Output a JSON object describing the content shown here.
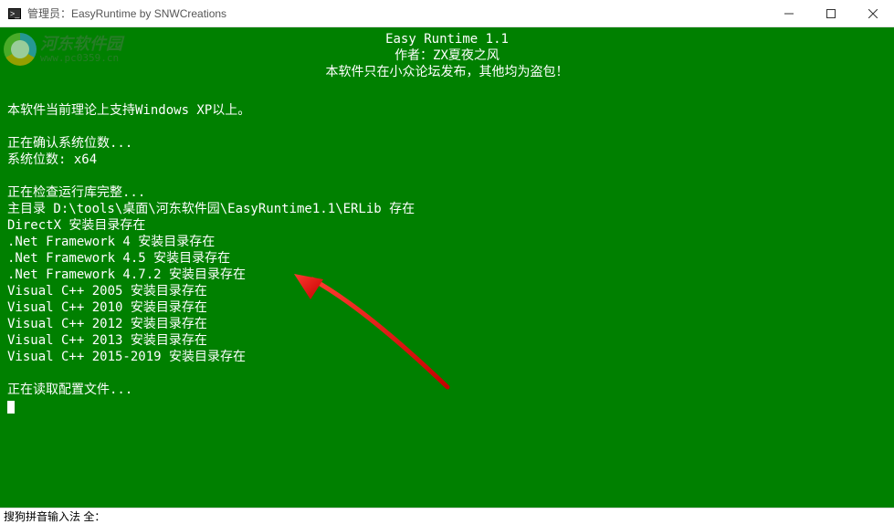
{
  "window": {
    "title": "管理员：EasyRuntime by SNWCreations",
    "controls": {
      "minimize": "—",
      "maximize": "☐",
      "close": "✕"
    }
  },
  "watermark": {
    "main": "河东软件园",
    "sub": "www.pc0359.cn"
  },
  "console": {
    "center": [
      "Easy Runtime 1.1",
      "作者：ZX夏夜之风",
      "本软件只在小众论坛发布，其他均为盗包！"
    ],
    "lines": [
      "",
      "本软件当前理论上支持Windows XP以上。",
      "",
      "正在确认系统位数...",
      "系统位数: x64",
      "",
      "正在检查运行库完整...",
      "主目录 D:\\tools\\桌面\\河东软件园\\EasyRuntime1.1\\ERLib 存在",
      "DirectX 安装目录存在",
      ".Net Framework 4 安装目录存在",
      ".Net Framework 4.5 安装目录存在",
      ".Net Framework 4.7.2 安装目录存在",
      "Visual C++ 2005 安装目录存在",
      "Visual C++ 2010 安装目录存在",
      "Visual C++ 2012 安装目录存在",
      "Visual C++ 2013 安装目录存在",
      "Visual C++ 2015-2019 安装目录存在",
      "",
      "正在读取配置文件..."
    ]
  },
  "ime": {
    "status": "搜狗拼音输入法  全："
  },
  "annotation": {
    "arrow": "red-arrow-pointing-left"
  }
}
